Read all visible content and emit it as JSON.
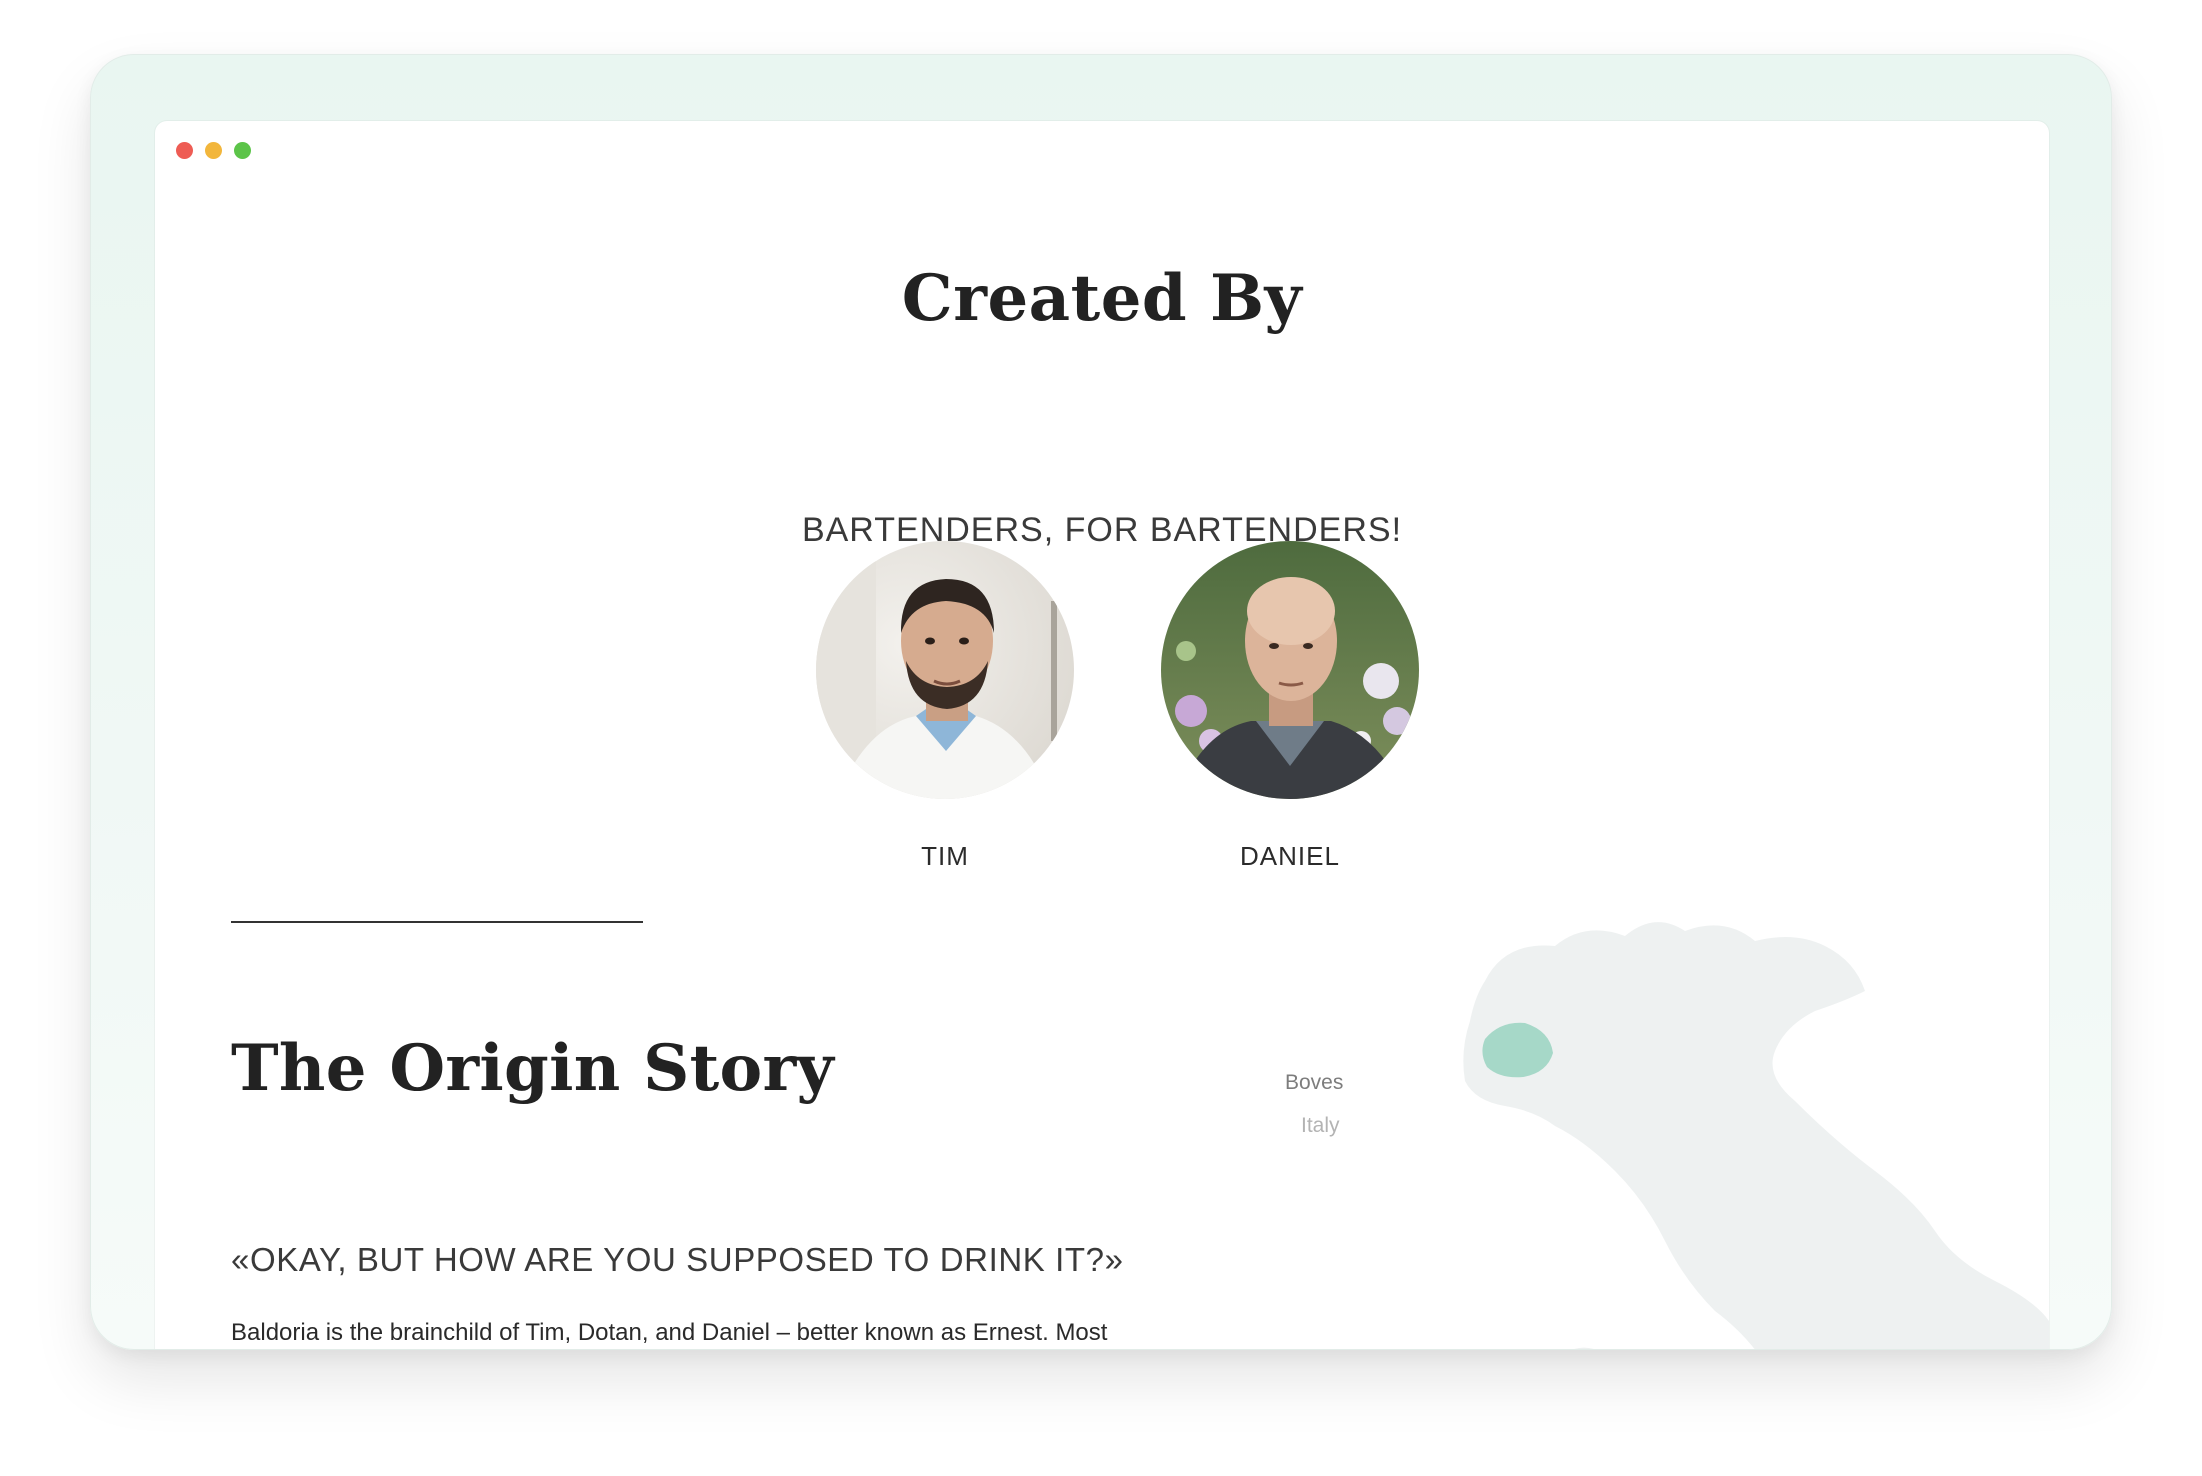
{
  "window": {
    "controls": [
      "close",
      "minimize",
      "maximize"
    ],
    "control_colors": [
      "#ee5c54",
      "#f2b63c",
      "#5cc449"
    ]
  },
  "created_by": {
    "title": "Created By",
    "subtitle": "BARTENDERS, FOR BARTENDERS!",
    "people": [
      {
        "name": "TIM",
        "avatar": "portrait-photo-tim"
      },
      {
        "name": "DANIEL",
        "avatar": "portrait-photo-daniel"
      }
    ]
  },
  "origin": {
    "title": "The Origin Story",
    "quote": "«OKAY, BUT HOW ARE YOU SUPPOSED TO DRINK IT?»",
    "body": "Baldoria is the brainchild of Tim, Dotan, and Daniel – better known as Ernest. Most of the members of Ernest work at the Little Red Door, a"
  },
  "map": {
    "labels": {
      "town": "Boves",
      "country": "Italy"
    },
    "colors": {
      "land": "#eef1f1",
      "highlight": "#a6d8c8"
    }
  }
}
